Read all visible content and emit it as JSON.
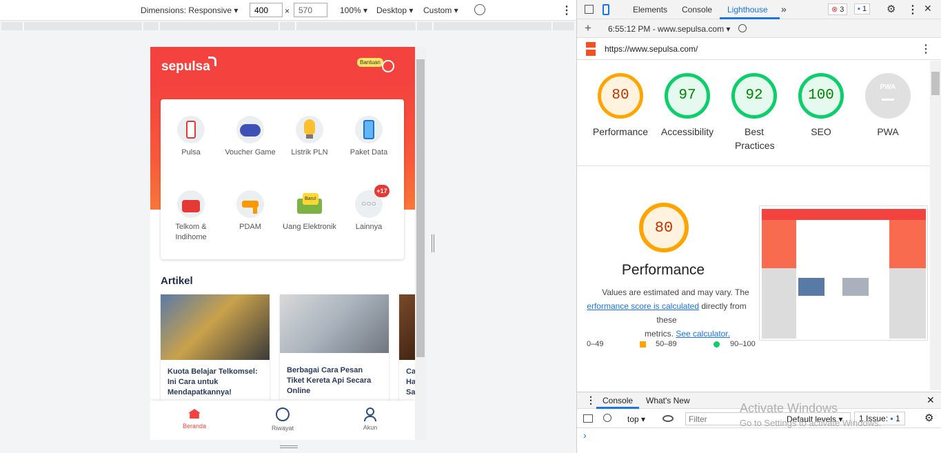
{
  "devicebar": {
    "dimensions": "Dimensions: Responsive",
    "width": "400",
    "height": "570",
    "zoom": "100%",
    "mode": "Desktop",
    "throttle": "Custom"
  },
  "app": {
    "logo": "sepulsa",
    "help_badge": "Bantuan",
    "services": [
      {
        "label": "Pulsa",
        "icon": "phone-icon"
      },
      {
        "label": "Voucher Game",
        "icon": "gamepad-icon"
      },
      {
        "label": "Listrik PLN",
        "icon": "lightbulb-icon"
      },
      {
        "label": "Paket Data",
        "icon": "mobile-data-icon"
      },
      {
        "label": "Telkom & Indihome",
        "icon": "telephone-icon"
      },
      {
        "label": "PDAM",
        "icon": "water-tap-icon"
      },
      {
        "label": "Uang Elektronik",
        "icon": "e-money-icon",
        "badge": "Baru!"
      },
      {
        "label": "Lainnya",
        "icon": "more-icon",
        "badge": "+17"
      }
    ],
    "articles_title": "Artikel",
    "articles": [
      {
        "title": "Kuota Belajar Telkomsel: Ini Cara untuk Mendapatkannya!"
      },
      {
        "title": "Berbagai Cara Pesan Tiket Kereta Api Secara Online"
      },
      {
        "title": "Ca Ha Sa"
      }
    ],
    "nav": [
      {
        "label": "Beranda"
      },
      {
        "label": "Riwayat"
      },
      {
        "label": "Akun"
      }
    ],
    "colors": {
      "brand": "#f4433f",
      "active_nav": "#f4433f"
    }
  },
  "devtools": {
    "tabs": [
      "Elements",
      "Console",
      "Lighthouse"
    ],
    "active_tab": "Lighthouse",
    "error_count": "3",
    "message_count": "1",
    "report_time": "6:55:12 PM - www.sepulsa.com",
    "url": "https://www.sepulsa.com/",
    "scores": [
      {
        "label": "Performance",
        "value": "80",
        "color": "#ffa400"
      },
      {
        "label": "Accessibility",
        "value": "97",
        "color": "#0cce6b"
      },
      {
        "label": "Best Practices",
        "value": "92",
        "color": "#0cce6b"
      },
      {
        "label": "SEO",
        "value": "100",
        "color": "#0cce6b"
      },
      {
        "label": "PWA",
        "value": "PWA",
        "color": "#cccccc"
      }
    ],
    "perf": {
      "value": "80",
      "title": "Performance",
      "text1": "Values are estimated and may vary. The",
      "link1": "erformance score is calculated",
      "text2": "directly from these",
      "text3": "metrics.",
      "link2": "See calculator."
    },
    "legend": [
      {
        "range": "0–49"
      },
      {
        "range": "50–89"
      },
      {
        "range": "90–100"
      }
    ],
    "console": {
      "tabs": [
        "Console",
        "What's New"
      ],
      "context": "top",
      "filter_placeholder": "Filter",
      "levels": "Default levels",
      "issues": "1 Issue:",
      "issue_count": "1",
      "prompt": "›"
    },
    "watermark_title": "Activate Windows",
    "watermark_sub": "Go to Settings to activate Windows."
  }
}
